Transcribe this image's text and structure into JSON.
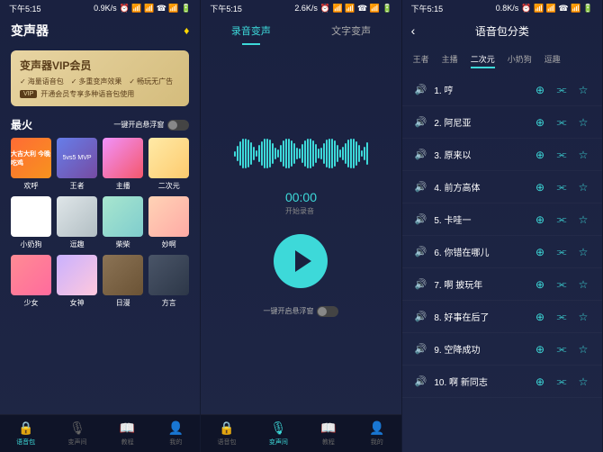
{
  "status": {
    "time": "下午5:15",
    "speeds": [
      "0.9K/s",
      "2.6K/s",
      "0.8K/s"
    ]
  },
  "screen1": {
    "title": "变声器",
    "vip": {
      "title": "变声器VIP会员",
      "features": [
        "海量语音包",
        "多重变声效果",
        "畅玩无广告"
      ],
      "badge": "VIP",
      "sub": "开通会员专享多种语音包使用"
    },
    "section": "最火",
    "toggle_label": "一键开启悬浮窗",
    "items": [
      {
        "label": "欢呼",
        "img": "大吉大利\n今晚吃鸡"
      },
      {
        "label": "王者",
        "img": "5vs5\nMVP"
      },
      {
        "label": "主播",
        "img": ""
      },
      {
        "label": "二次元",
        "img": ""
      },
      {
        "label": "小奶狗",
        "img": ""
      },
      {
        "label": "逗趣",
        "img": ""
      },
      {
        "label": "柴柴",
        "img": ""
      },
      {
        "label": "妙啊",
        "img": ""
      },
      {
        "label": "少女",
        "img": ""
      },
      {
        "label": "女神",
        "img": ""
      },
      {
        "label": "日漫",
        "img": ""
      },
      {
        "label": "方言",
        "img": ""
      }
    ]
  },
  "screen2": {
    "tabs": [
      "录音变声",
      "文字变声"
    ],
    "timer": "00:00",
    "timer_sub": "开始录音",
    "toggle_label": "一键开启悬浮窗"
  },
  "screen3": {
    "title": "语音包分类",
    "filters": [
      "王者",
      "主播",
      "二次元",
      "小奶狗",
      "逗趣"
    ],
    "items": [
      "1. 哼",
      "2. 阿尼亚",
      "3. 原来以",
      "4. 前方高体",
      "5. 卡哇一",
      "6. 你错在哪儿",
      "7. 啊 披玩年",
      "8. 好事在后了",
      "9. 空降成功",
      "10. 啊 新同志"
    ]
  },
  "nav": [
    "语音包",
    "变声间",
    "教程",
    "我的"
  ]
}
